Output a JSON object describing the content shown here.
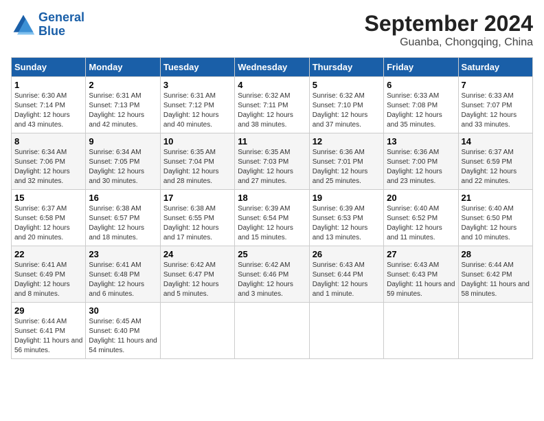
{
  "header": {
    "logo_line1": "General",
    "logo_line2": "Blue",
    "month": "September 2024",
    "location": "Guanba, Chongqing, China"
  },
  "weekdays": [
    "Sunday",
    "Monday",
    "Tuesday",
    "Wednesday",
    "Thursday",
    "Friday",
    "Saturday"
  ],
  "weeks": [
    [
      {
        "day": "1",
        "sunrise": "6:30 AM",
        "sunset": "7:14 PM",
        "daylight": "12 hours and 43 minutes."
      },
      {
        "day": "2",
        "sunrise": "6:31 AM",
        "sunset": "7:13 PM",
        "daylight": "12 hours and 42 minutes."
      },
      {
        "day": "3",
        "sunrise": "6:31 AM",
        "sunset": "7:12 PM",
        "daylight": "12 hours and 40 minutes."
      },
      {
        "day": "4",
        "sunrise": "6:32 AM",
        "sunset": "7:11 PM",
        "daylight": "12 hours and 38 minutes."
      },
      {
        "day": "5",
        "sunrise": "6:32 AM",
        "sunset": "7:10 PM",
        "daylight": "12 hours and 37 minutes."
      },
      {
        "day": "6",
        "sunrise": "6:33 AM",
        "sunset": "7:08 PM",
        "daylight": "12 hours and 35 minutes."
      },
      {
        "day": "7",
        "sunrise": "6:33 AM",
        "sunset": "7:07 PM",
        "daylight": "12 hours and 33 minutes."
      }
    ],
    [
      {
        "day": "8",
        "sunrise": "6:34 AM",
        "sunset": "7:06 PM",
        "daylight": "12 hours and 32 minutes."
      },
      {
        "day": "9",
        "sunrise": "6:34 AM",
        "sunset": "7:05 PM",
        "daylight": "12 hours and 30 minutes."
      },
      {
        "day": "10",
        "sunrise": "6:35 AM",
        "sunset": "7:04 PM",
        "daylight": "12 hours and 28 minutes."
      },
      {
        "day": "11",
        "sunrise": "6:35 AM",
        "sunset": "7:03 PM",
        "daylight": "12 hours and 27 minutes."
      },
      {
        "day": "12",
        "sunrise": "6:36 AM",
        "sunset": "7:01 PM",
        "daylight": "12 hours and 25 minutes."
      },
      {
        "day": "13",
        "sunrise": "6:36 AM",
        "sunset": "7:00 PM",
        "daylight": "12 hours and 23 minutes."
      },
      {
        "day": "14",
        "sunrise": "6:37 AM",
        "sunset": "6:59 PM",
        "daylight": "12 hours and 22 minutes."
      }
    ],
    [
      {
        "day": "15",
        "sunrise": "6:37 AM",
        "sunset": "6:58 PM",
        "daylight": "12 hours and 20 minutes."
      },
      {
        "day": "16",
        "sunrise": "6:38 AM",
        "sunset": "6:57 PM",
        "daylight": "12 hours and 18 minutes."
      },
      {
        "day": "17",
        "sunrise": "6:38 AM",
        "sunset": "6:55 PM",
        "daylight": "12 hours and 17 minutes."
      },
      {
        "day": "18",
        "sunrise": "6:39 AM",
        "sunset": "6:54 PM",
        "daylight": "12 hours and 15 minutes."
      },
      {
        "day": "19",
        "sunrise": "6:39 AM",
        "sunset": "6:53 PM",
        "daylight": "12 hours and 13 minutes."
      },
      {
        "day": "20",
        "sunrise": "6:40 AM",
        "sunset": "6:52 PM",
        "daylight": "12 hours and 11 minutes."
      },
      {
        "day": "21",
        "sunrise": "6:40 AM",
        "sunset": "6:50 PM",
        "daylight": "12 hours and 10 minutes."
      }
    ],
    [
      {
        "day": "22",
        "sunrise": "6:41 AM",
        "sunset": "6:49 PM",
        "daylight": "12 hours and 8 minutes."
      },
      {
        "day": "23",
        "sunrise": "6:41 AM",
        "sunset": "6:48 PM",
        "daylight": "12 hours and 6 minutes."
      },
      {
        "day": "24",
        "sunrise": "6:42 AM",
        "sunset": "6:47 PM",
        "daylight": "12 hours and 5 minutes."
      },
      {
        "day": "25",
        "sunrise": "6:42 AM",
        "sunset": "6:46 PM",
        "daylight": "12 hours and 3 minutes."
      },
      {
        "day": "26",
        "sunrise": "6:43 AM",
        "sunset": "6:44 PM",
        "daylight": "12 hours and 1 minute."
      },
      {
        "day": "27",
        "sunrise": "6:43 AM",
        "sunset": "6:43 PM",
        "daylight": "11 hours and 59 minutes."
      },
      {
        "day": "28",
        "sunrise": "6:44 AM",
        "sunset": "6:42 PM",
        "daylight": "11 hours and 58 minutes."
      }
    ],
    [
      {
        "day": "29",
        "sunrise": "6:44 AM",
        "sunset": "6:41 PM",
        "daylight": "11 hours and 56 minutes."
      },
      {
        "day": "30",
        "sunrise": "6:45 AM",
        "sunset": "6:40 PM",
        "daylight": "11 hours and 54 minutes."
      },
      null,
      null,
      null,
      null,
      null
    ]
  ]
}
